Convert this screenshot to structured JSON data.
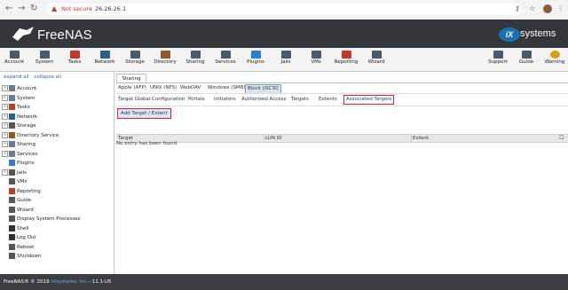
{
  "browser": {
    "security_label": "Not secure",
    "url": "26.26.26.1"
  },
  "brand": {
    "logo_text": "FreeNAS",
    "ix_badge": "iX",
    "ix_text": "systems"
  },
  "toolbar": {
    "items": [
      "Account",
      "System",
      "Tasks",
      "Network",
      "Storage",
      "Directory",
      "Sharing",
      "Services",
      "Plugins",
      "Jails",
      "VMs",
      "Reporting",
      "Wizard"
    ],
    "right_items": [
      "Support",
      "Guide",
      "Warning"
    ]
  },
  "sidebar": {
    "expand_label": "expand all",
    "collapse_label": "collapse all",
    "items": [
      {
        "label": "Account",
        "expandable": true,
        "icon_color": "#6b7c8f"
      },
      {
        "label": "System",
        "expandable": true,
        "icon_color": "#6b7c8f"
      },
      {
        "label": "Tasks",
        "expandable": true,
        "icon_color": "#c0392b"
      },
      {
        "label": "Network",
        "expandable": true,
        "icon_color": "#2c5f8a"
      },
      {
        "label": "Storage",
        "expandable": true,
        "icon_color": "#555555"
      },
      {
        "label": "Directory Service",
        "expandable": true,
        "icon_color": "#8a5a2c"
      },
      {
        "label": "Sharing",
        "expandable": true,
        "icon_color": "#6b7c8f"
      },
      {
        "label": "Services",
        "expandable": true,
        "icon_color": "#6b7c8f"
      },
      {
        "label": "Plugins",
        "expandable": false,
        "icon_color": "#2a7fd4"
      },
      {
        "label": "Jails",
        "expandable": true,
        "icon_color": "#555555"
      },
      {
        "label": "VMs",
        "expandable": false,
        "icon_color": "#555555"
      },
      {
        "label": "Reporting",
        "expandable": false,
        "icon_color": "#c0392b"
      },
      {
        "label": "Guide",
        "expandable": false,
        "icon_color": "#555555"
      },
      {
        "label": "Wizard",
        "expandable": false,
        "icon_color": "#555555"
      },
      {
        "label": "Display System Processes",
        "expandable": false,
        "icon_color": "#555555"
      },
      {
        "label": "Shell",
        "expandable": false,
        "icon_color": "#333333"
      },
      {
        "label": "Log Out",
        "expandable": false,
        "icon_color": "#333333"
      },
      {
        "label": "Reboot",
        "expandable": false,
        "icon_color": "#555555"
      },
      {
        "label": "Shutdown",
        "expandable": false,
        "icon_color": "#555555"
      }
    ]
  },
  "main": {
    "top_tab": "Sharing",
    "share_tabs": [
      "Apple (AFP)",
      "UNIX (NFS)",
      "WebDAV",
      "Windows (SMB)",
      "Block (iSCSI)"
    ],
    "iscsi_tabs": [
      "Target Global Configuration",
      "Portals",
      "Initiators",
      "Authorized Access",
      "Targets",
      "Extents",
      "Associated Targets"
    ],
    "add_button": "Add Target / Extent",
    "table": {
      "columns": [
        "Target",
        "LUN ID",
        "Extent"
      ],
      "empty_text": "No entry has been found"
    }
  },
  "footer": {
    "prefix": "FreeNAS® © 2019 - ",
    "company": "iXsystems, Inc.",
    "version": " - 11.1-U5"
  },
  "colors": {
    "banner": "#33363a",
    "highlight_red": "#d8242c",
    "active_tab_bg": "#d7e4f2"
  }
}
